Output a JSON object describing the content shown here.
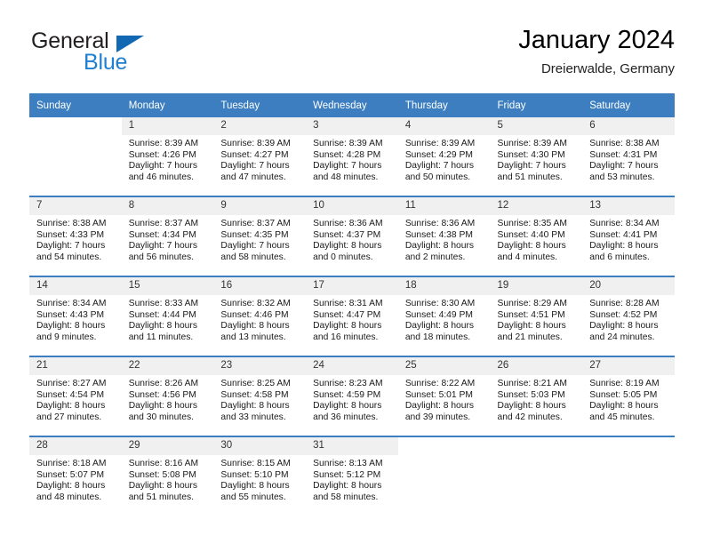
{
  "brand": {
    "name_part1": "General",
    "name_part2": "Blue",
    "logo_icon": "triangle-logo-icon"
  },
  "header": {
    "title": "January 2024",
    "subtitle": "Dreierwalde, Germany"
  },
  "colors": {
    "header_blue": "#3c7ebf",
    "brand_blue": "#1f7fd0",
    "logo_blue": "#1268b3",
    "daynum_band": "#f0f0f0"
  },
  "weekdays": [
    "Sunday",
    "Monday",
    "Tuesday",
    "Wednesday",
    "Thursday",
    "Friday",
    "Saturday"
  ],
  "weeks": [
    [
      {
        "day": "",
        "sunrise": "",
        "sunset": "",
        "daylight1": "",
        "daylight2": ""
      },
      {
        "day": "1",
        "sunrise": "Sunrise: 8:39 AM",
        "sunset": "Sunset: 4:26 PM",
        "daylight1": "Daylight: 7 hours",
        "daylight2": "and 46 minutes."
      },
      {
        "day": "2",
        "sunrise": "Sunrise: 8:39 AM",
        "sunset": "Sunset: 4:27 PM",
        "daylight1": "Daylight: 7 hours",
        "daylight2": "and 47 minutes."
      },
      {
        "day": "3",
        "sunrise": "Sunrise: 8:39 AM",
        "sunset": "Sunset: 4:28 PM",
        "daylight1": "Daylight: 7 hours",
        "daylight2": "and 48 minutes."
      },
      {
        "day": "4",
        "sunrise": "Sunrise: 8:39 AM",
        "sunset": "Sunset: 4:29 PM",
        "daylight1": "Daylight: 7 hours",
        "daylight2": "and 50 minutes."
      },
      {
        "day": "5",
        "sunrise": "Sunrise: 8:39 AM",
        "sunset": "Sunset: 4:30 PM",
        "daylight1": "Daylight: 7 hours",
        "daylight2": "and 51 minutes."
      },
      {
        "day": "6",
        "sunrise": "Sunrise: 8:38 AM",
        "sunset": "Sunset: 4:31 PM",
        "daylight1": "Daylight: 7 hours",
        "daylight2": "and 53 minutes."
      }
    ],
    [
      {
        "day": "7",
        "sunrise": "Sunrise: 8:38 AM",
        "sunset": "Sunset: 4:33 PM",
        "daylight1": "Daylight: 7 hours",
        "daylight2": "and 54 minutes."
      },
      {
        "day": "8",
        "sunrise": "Sunrise: 8:37 AM",
        "sunset": "Sunset: 4:34 PM",
        "daylight1": "Daylight: 7 hours",
        "daylight2": "and 56 minutes."
      },
      {
        "day": "9",
        "sunrise": "Sunrise: 8:37 AM",
        "sunset": "Sunset: 4:35 PM",
        "daylight1": "Daylight: 7 hours",
        "daylight2": "and 58 minutes."
      },
      {
        "day": "10",
        "sunrise": "Sunrise: 8:36 AM",
        "sunset": "Sunset: 4:37 PM",
        "daylight1": "Daylight: 8 hours",
        "daylight2": "and 0 minutes."
      },
      {
        "day": "11",
        "sunrise": "Sunrise: 8:36 AM",
        "sunset": "Sunset: 4:38 PM",
        "daylight1": "Daylight: 8 hours",
        "daylight2": "and 2 minutes."
      },
      {
        "day": "12",
        "sunrise": "Sunrise: 8:35 AM",
        "sunset": "Sunset: 4:40 PM",
        "daylight1": "Daylight: 8 hours",
        "daylight2": "and 4 minutes."
      },
      {
        "day": "13",
        "sunrise": "Sunrise: 8:34 AM",
        "sunset": "Sunset: 4:41 PM",
        "daylight1": "Daylight: 8 hours",
        "daylight2": "and 6 minutes."
      }
    ],
    [
      {
        "day": "14",
        "sunrise": "Sunrise: 8:34 AM",
        "sunset": "Sunset: 4:43 PM",
        "daylight1": "Daylight: 8 hours",
        "daylight2": "and 9 minutes."
      },
      {
        "day": "15",
        "sunrise": "Sunrise: 8:33 AM",
        "sunset": "Sunset: 4:44 PM",
        "daylight1": "Daylight: 8 hours",
        "daylight2": "and 11 minutes."
      },
      {
        "day": "16",
        "sunrise": "Sunrise: 8:32 AM",
        "sunset": "Sunset: 4:46 PM",
        "daylight1": "Daylight: 8 hours",
        "daylight2": "and 13 minutes."
      },
      {
        "day": "17",
        "sunrise": "Sunrise: 8:31 AM",
        "sunset": "Sunset: 4:47 PM",
        "daylight1": "Daylight: 8 hours",
        "daylight2": "and 16 minutes."
      },
      {
        "day": "18",
        "sunrise": "Sunrise: 8:30 AM",
        "sunset": "Sunset: 4:49 PM",
        "daylight1": "Daylight: 8 hours",
        "daylight2": "and 18 minutes."
      },
      {
        "day": "19",
        "sunrise": "Sunrise: 8:29 AM",
        "sunset": "Sunset: 4:51 PM",
        "daylight1": "Daylight: 8 hours",
        "daylight2": "and 21 minutes."
      },
      {
        "day": "20",
        "sunrise": "Sunrise: 8:28 AM",
        "sunset": "Sunset: 4:52 PM",
        "daylight1": "Daylight: 8 hours",
        "daylight2": "and 24 minutes."
      }
    ],
    [
      {
        "day": "21",
        "sunrise": "Sunrise: 8:27 AM",
        "sunset": "Sunset: 4:54 PM",
        "daylight1": "Daylight: 8 hours",
        "daylight2": "and 27 minutes."
      },
      {
        "day": "22",
        "sunrise": "Sunrise: 8:26 AM",
        "sunset": "Sunset: 4:56 PM",
        "daylight1": "Daylight: 8 hours",
        "daylight2": "and 30 minutes."
      },
      {
        "day": "23",
        "sunrise": "Sunrise: 8:25 AM",
        "sunset": "Sunset: 4:58 PM",
        "daylight1": "Daylight: 8 hours",
        "daylight2": "and 33 minutes."
      },
      {
        "day": "24",
        "sunrise": "Sunrise: 8:23 AM",
        "sunset": "Sunset: 4:59 PM",
        "daylight1": "Daylight: 8 hours",
        "daylight2": "and 36 minutes."
      },
      {
        "day": "25",
        "sunrise": "Sunrise: 8:22 AM",
        "sunset": "Sunset: 5:01 PM",
        "daylight1": "Daylight: 8 hours",
        "daylight2": "and 39 minutes."
      },
      {
        "day": "26",
        "sunrise": "Sunrise: 8:21 AM",
        "sunset": "Sunset: 5:03 PM",
        "daylight1": "Daylight: 8 hours",
        "daylight2": "and 42 minutes."
      },
      {
        "day": "27",
        "sunrise": "Sunrise: 8:19 AM",
        "sunset": "Sunset: 5:05 PM",
        "daylight1": "Daylight: 8 hours",
        "daylight2": "and 45 minutes."
      }
    ],
    [
      {
        "day": "28",
        "sunrise": "Sunrise: 8:18 AM",
        "sunset": "Sunset: 5:07 PM",
        "daylight1": "Daylight: 8 hours",
        "daylight2": "and 48 minutes."
      },
      {
        "day": "29",
        "sunrise": "Sunrise: 8:16 AM",
        "sunset": "Sunset: 5:08 PM",
        "daylight1": "Daylight: 8 hours",
        "daylight2": "and 51 minutes."
      },
      {
        "day": "30",
        "sunrise": "Sunrise: 8:15 AM",
        "sunset": "Sunset: 5:10 PM",
        "daylight1": "Daylight: 8 hours",
        "daylight2": "and 55 minutes."
      },
      {
        "day": "31",
        "sunrise": "Sunrise: 8:13 AM",
        "sunset": "Sunset: 5:12 PM",
        "daylight1": "Daylight: 8 hours",
        "daylight2": "and 58 minutes."
      },
      {
        "day": "",
        "sunrise": "",
        "sunset": "",
        "daylight1": "",
        "daylight2": ""
      },
      {
        "day": "",
        "sunrise": "",
        "sunset": "",
        "daylight1": "",
        "daylight2": ""
      },
      {
        "day": "",
        "sunrise": "",
        "sunset": "",
        "daylight1": "",
        "daylight2": ""
      }
    ]
  ]
}
